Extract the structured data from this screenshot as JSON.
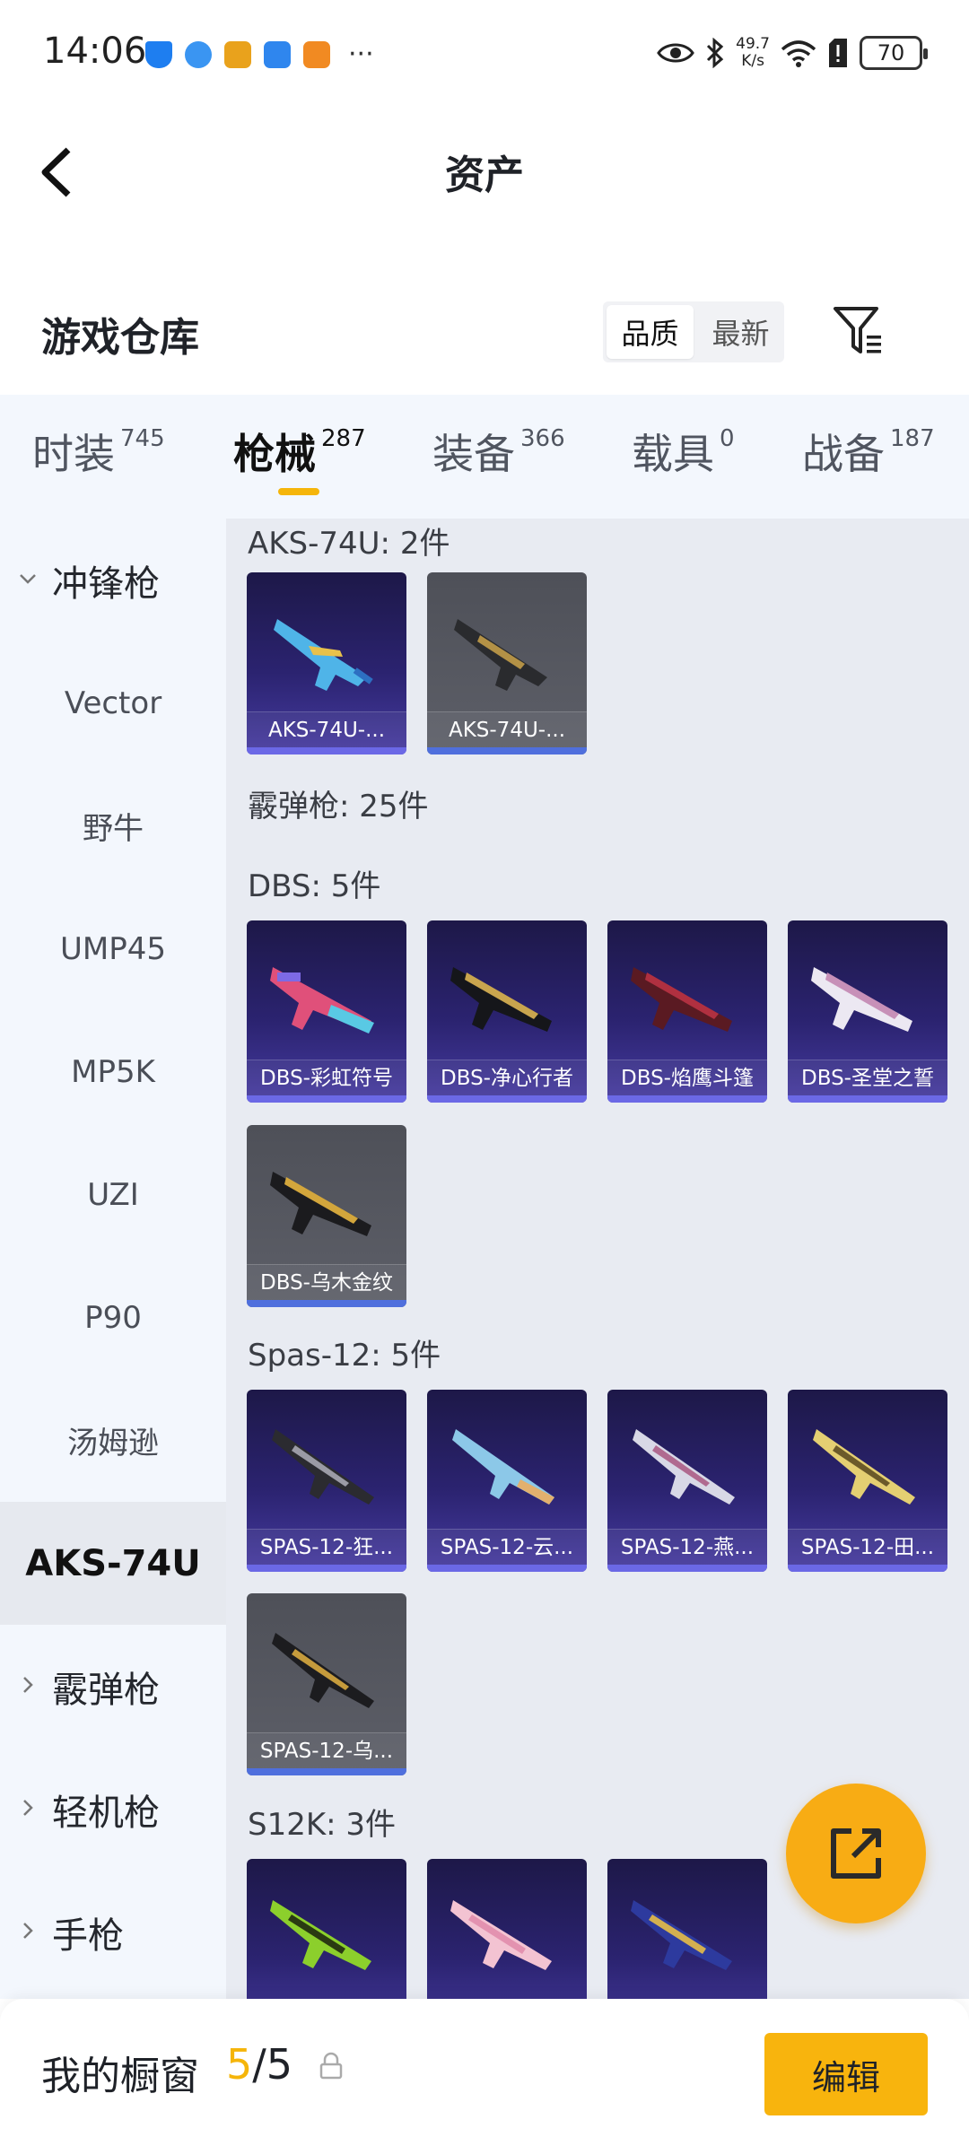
{
  "status": {
    "time": "14:06",
    "speed_top": "49.7",
    "speed_unit": "K/s",
    "battery": "70",
    "more": "···"
  },
  "header": {
    "title": "资产"
  },
  "warehouse": {
    "title": "游戏仓库",
    "sort_options": [
      "品质",
      "最新"
    ],
    "sort_selected": "品质"
  },
  "tabs": [
    {
      "label": "时装",
      "count": "745"
    },
    {
      "label": "枪械",
      "count": "287"
    },
    {
      "label": "装备",
      "count": "366"
    },
    {
      "label": "载具",
      "count": "0"
    },
    {
      "label": "战备",
      "count": "187"
    }
  ],
  "active_tab": "枪械",
  "sidebar": {
    "groups": [
      "冲锋枪",
      "霰弹枪",
      "轻机枪",
      "手枪"
    ],
    "items": [
      "Vector",
      "野牛",
      "UMP45",
      "MP5K",
      "UZI",
      "P90",
      "汤姆逊",
      "AKS-74U"
    ],
    "active_item": "AKS-74U"
  },
  "content": {
    "sections": {
      "aks": "AKS-74U: 2件",
      "shotgun": "霰弹枪: 25件",
      "dbs": "DBS: 5件",
      "spas": "Spas-12: 5件",
      "s12k": "S12K: 3件"
    },
    "aks_cards": [
      "AKS-74U-...",
      "AKS-74U-..."
    ],
    "dbs_cards": [
      "DBS-彩虹符号",
      "DBS-净心行者",
      "DBS-焰鹰斗篷",
      "DBS-圣堂之誓",
      "DBS-乌木金纹"
    ],
    "spas_cards": [
      "SPAS-12-狂...",
      "SPAS-12-云...",
      "SPAS-12-燕...",
      "SPAS-12-田...",
      "SPAS-12-乌..."
    ]
  },
  "bottom": {
    "title": "我的橱窗",
    "current": "5",
    "total": "/5",
    "edit_label": "编辑"
  },
  "colors": {
    "accent": "#f8b40d",
    "tab_bg": "#f3f7fd",
    "content_bg": "#e8ebf2",
    "card_purple": "#2b2370",
    "card_grey": "#5d5f68"
  }
}
